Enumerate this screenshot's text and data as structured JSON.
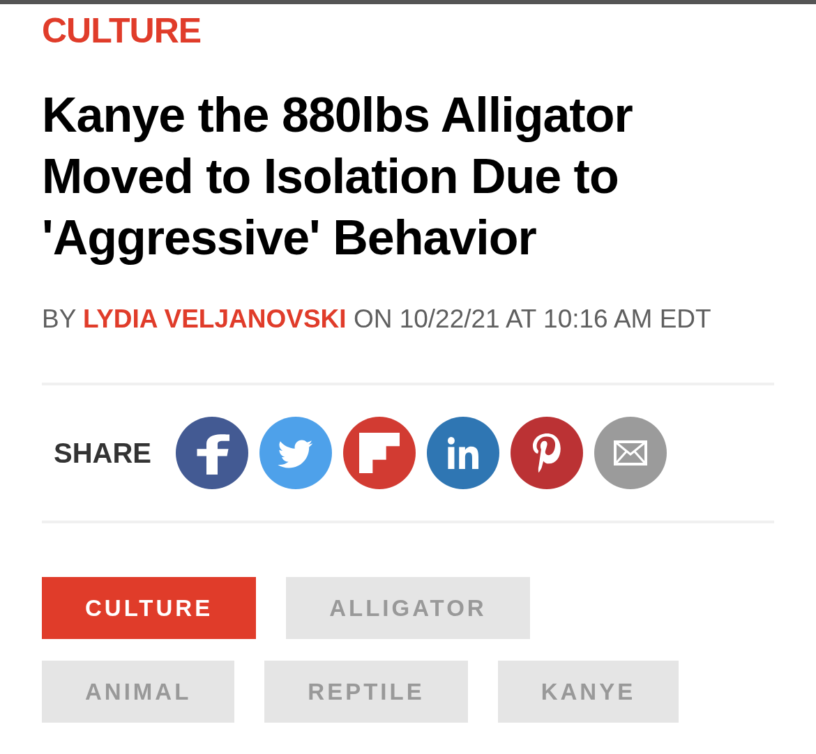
{
  "category": "CULTURE",
  "headline": "Kanye the 880lbs Alligator Moved to Isolation Due to 'Aggressive' Behavior",
  "byline": {
    "prefix": "BY",
    "author": "LYDIA VELJANOVSKI",
    "dateline": "ON 10/22/21 AT 10:16 AM EDT"
  },
  "share": {
    "label": "SHARE",
    "buttons": [
      {
        "kind": "facebook"
      },
      {
        "kind": "twitter"
      },
      {
        "kind": "flipboard"
      },
      {
        "kind": "linkedin"
      },
      {
        "kind": "pinterest"
      },
      {
        "kind": "email"
      }
    ]
  },
  "tags": [
    {
      "label": "CULTURE",
      "kind": "section"
    },
    {
      "label": "ALLIGATOR",
      "kind": "tag"
    },
    {
      "label": "ANIMAL",
      "kind": "tag"
    },
    {
      "label": "REPTILE",
      "kind": "tag"
    },
    {
      "label": "KANYE",
      "kind": "tag"
    }
  ]
}
